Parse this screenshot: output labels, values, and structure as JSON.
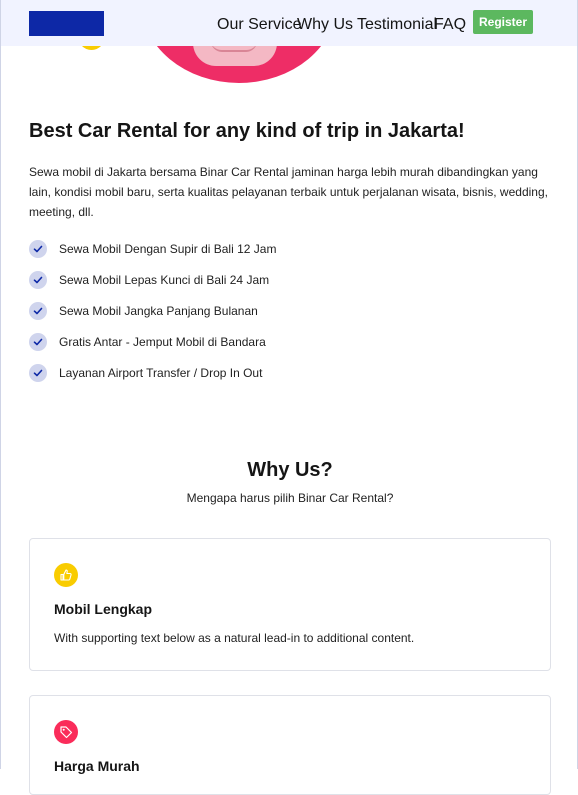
{
  "nav": {
    "items": [
      "Our Service",
      "Why Us",
      "Testimonial",
      "FAQ"
    ],
    "register_label": "Register"
  },
  "hero": {
    "title": "Best Car Rental for any kind of trip in Jakarta!",
    "description": "Sewa mobil di Jakarta bersama Binar Car Rental jaminan harga lebih murah dibandingkan yang lain, kondisi mobil baru, serta kualitas pelayanan terbaik untuk perjalanan wisata, bisnis, wedding, meeting, dll.",
    "features": [
      "Sewa Mobil Dengan Supir di Bali 12 Jam",
      "Sewa Mobil Lepas Kunci di Bali 24 Jam",
      "Sewa Mobil Jangka Panjang Bulanan",
      "Gratis Antar - Jemput Mobil di Bandara",
      "Layanan Airport Transfer / Drop In Out"
    ]
  },
  "why_us": {
    "title": "Why Us?",
    "subtitle": "Mengapa harus pilih Binar Car Rental?",
    "cards": [
      {
        "title": "Mobil Lengkap",
        "text": "With supporting text below as a natural lead-in to additional content.",
        "icon": "thumbs-up-icon",
        "color": "#f9cc00"
      },
      {
        "title": "Harga Murah",
        "text": "",
        "icon": "tag-icon",
        "color": "#fa2c5a"
      }
    ]
  },
  "colors": {
    "brand": "#0d28a6",
    "register": "#5cb85f",
    "hero_accent": "#ee2d66",
    "check_bg": "#cfd4ed",
    "topbar_bg": "#f1f3ff"
  }
}
